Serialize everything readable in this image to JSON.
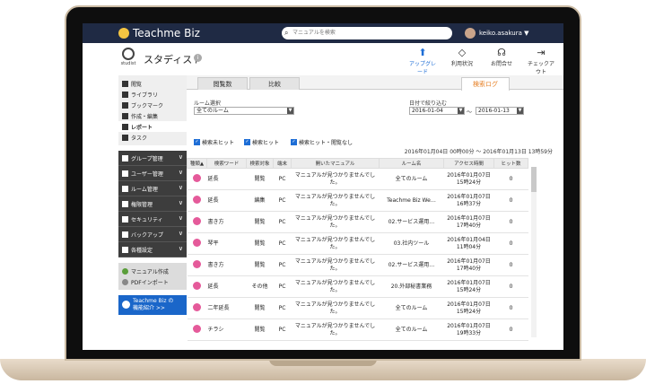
{
  "app": {
    "logo_text": "Teachme Biz",
    "search_placeholder": "マニュアルを検索",
    "user_name": "keiko.asakura ▼"
  },
  "header": {
    "company": "スタディスト",
    "logo_caption": "studist",
    "nav": [
      {
        "label": "アップグレード",
        "icon": "upgrade-icon",
        "glyph": "⬆"
      },
      {
        "label": "利用状況",
        "icon": "shield-icon",
        "glyph": "◇"
      },
      {
        "label": "お問合せ",
        "icon": "headset-icon",
        "glyph": "☊"
      },
      {
        "label": "チェックアウト",
        "icon": "exit-icon",
        "glyph": "⇥"
      }
    ]
  },
  "sidebar": {
    "main_items": [
      "閲覧",
      "ライブラリ",
      "ブックマーク",
      "作成・編集",
      "レポート",
      "タスク"
    ],
    "admin_items": [
      "グループ管理",
      "ユーザー管理",
      "ルーム管理",
      "権限管理",
      "セキュリティ",
      "バックアップ",
      "各種設定"
    ],
    "tools": [
      "マニュアル作成",
      "PDFインポート"
    ],
    "promo_line1": "Teachme Biz の",
    "promo_line2": "機能紹介 >>"
  },
  "tabs": {
    "views": "閲覧数",
    "compare": "比較",
    "search_log": "検索ログ"
  },
  "filters": {
    "room_label": "ルーム選択",
    "room_value": "全てのルーム",
    "date_label": "日付で絞り込む",
    "date_from": "2016-01-04",
    "date_to": "2016-01-13",
    "date_sep": "〜",
    "checkboxes": [
      "検索未ヒット",
      "検索ヒット",
      "検索ヒット・閲覧なし"
    ],
    "range_text": "2016年01月04日 00時00分 〜 2016年01月13日 13時59分"
  },
  "table": {
    "headers": [
      "種類▲",
      "検索ワード",
      "検索対象",
      "端末",
      "開いたマニュアル",
      "ルーム名",
      "アクセス時間",
      "ヒット数"
    ],
    "rows": [
      {
        "word": "延長",
        "target": "閲覧",
        "device": "PC",
        "manual": "マニュアルが見つかりませんでした。",
        "room": "全てのルーム",
        "date": "2016年01月07日",
        "time": "15時24分",
        "hits": "0"
      },
      {
        "word": "延長",
        "target": "編集",
        "device": "PC",
        "manual": "マニュアルが見つかりませんでした。",
        "room": "Teachme Biz We…",
        "date": "2016年01月07日",
        "time": "16時37分",
        "hits": "0"
      },
      {
        "word": "書き方",
        "target": "閲覧",
        "device": "PC",
        "manual": "マニュアルが見つかりませんでした。",
        "room": "02.サービス運用…",
        "date": "2016年01月07日",
        "time": "17時40分",
        "hits": "0"
      },
      {
        "word": "琴平",
        "target": "閲覧",
        "device": "PC",
        "manual": "マニュアルが見つかりませんでした。",
        "room": "03.社内ツール",
        "date": "2016年01月04日",
        "time": "11時04分",
        "hits": "0"
      },
      {
        "word": "書き方",
        "target": "閲覧",
        "device": "PC",
        "manual": "マニュアルが見つかりませんでした。",
        "room": "02.サービス運用…",
        "date": "2016年01月07日",
        "time": "17時40分",
        "hits": "0"
      },
      {
        "word": "延長",
        "target": "その他",
        "device": "PC",
        "manual": "マニュアルが見つかりませんでした。",
        "room": "20.外部秘書業務",
        "date": "2016年01月07日",
        "time": "15時24分",
        "hits": "0"
      },
      {
        "word": "二年延長",
        "target": "閲覧",
        "device": "PC",
        "manual": "マニュアルが見つかりませんでした。",
        "room": "全てのルーム",
        "date": "2016年01月07日",
        "time": "15時24分",
        "hits": "0"
      },
      {
        "word": "チラシ",
        "target": "閲覧",
        "device": "PC",
        "manual": "マニュアルが見つかりませんでした。",
        "room": "全てのルーム",
        "date": "2016年01月07日",
        "time": "19時33分",
        "hits": "0"
      }
    ]
  },
  "colors": {
    "topbar": "#1f2a44",
    "accent_orange": "#e67e22",
    "accent_blue": "#1e6ed6",
    "tag_pink": "#e55a9a"
  }
}
